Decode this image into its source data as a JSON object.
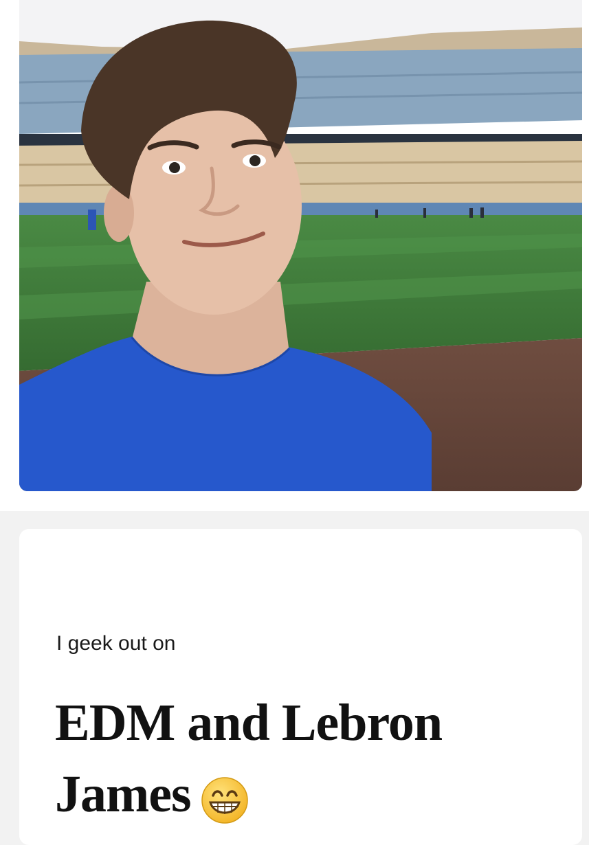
{
  "photo": {
    "icon": "selfie-photo",
    "colors": {
      "sky": "#f4f4f6",
      "stands": "#8fa8bf",
      "grass": "#3f7a3a",
      "dirt": "#6b4a3e",
      "shirt": "#2558c8"
    }
  },
  "prompt": {
    "label": "I geek out on",
    "answer": "EDM and Lebron James",
    "emoji": "grinning-face-icon"
  }
}
